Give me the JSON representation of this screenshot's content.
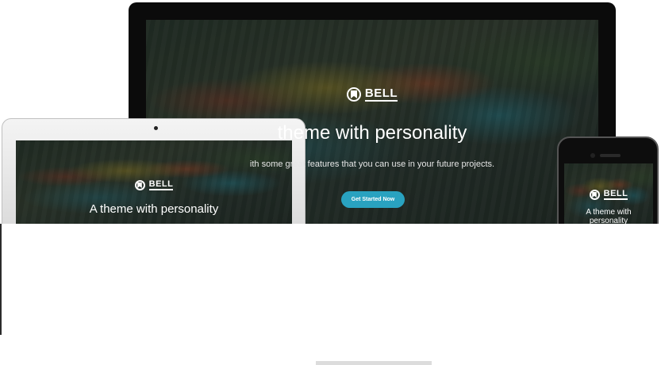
{
  "brand": {
    "name": "BELL",
    "icon": "bookmark-icon"
  },
  "monitor": {
    "headline": "theme with personality",
    "subtext": "ith some great features that you can use in your future projects.",
    "cta_label": "Get Started Now"
  },
  "laptop": {
    "headline": "A theme with personality"
  },
  "phone": {
    "headline": "A theme with personality"
  },
  "colors": {
    "accent": "#29a2c0",
    "text": "#ffffff",
    "frame_dark": "#0b0b0b",
    "frame_light": "#e6e6e6"
  }
}
